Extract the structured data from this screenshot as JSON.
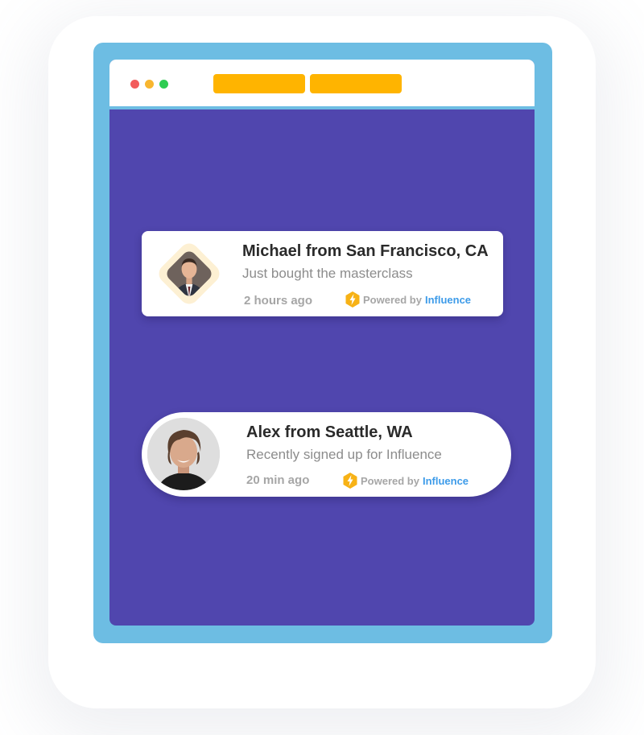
{
  "colors": {
    "frame": "#6dbde3",
    "window_bg": "#5046ae",
    "dot_red": "#f25b5b",
    "dot_yellow": "#f8b62f",
    "dot_green": "#2ecc52",
    "tab": "#ffb400",
    "diamond_bg": "#fdf0d3",
    "brand": "#3d9be9",
    "bolt": "#f7b216"
  },
  "browser": {
    "tabs": [
      "",
      ""
    ]
  },
  "notifications": [
    {
      "name": "Michael from San Francisco, CA",
      "action": "Just bought the masterclass",
      "time": "2 hours ago",
      "powered_by": "Powered by",
      "brand": "Influence",
      "avatar_icon": "man-in-suit-avatar-icon"
    },
    {
      "name": "Alex from Seattle, WA",
      "action": "Recently signed up for Influence",
      "time": "20 min ago",
      "powered_by": "Powered by",
      "brand": "Influence",
      "avatar_icon": "smiling-man-avatar-icon"
    }
  ]
}
